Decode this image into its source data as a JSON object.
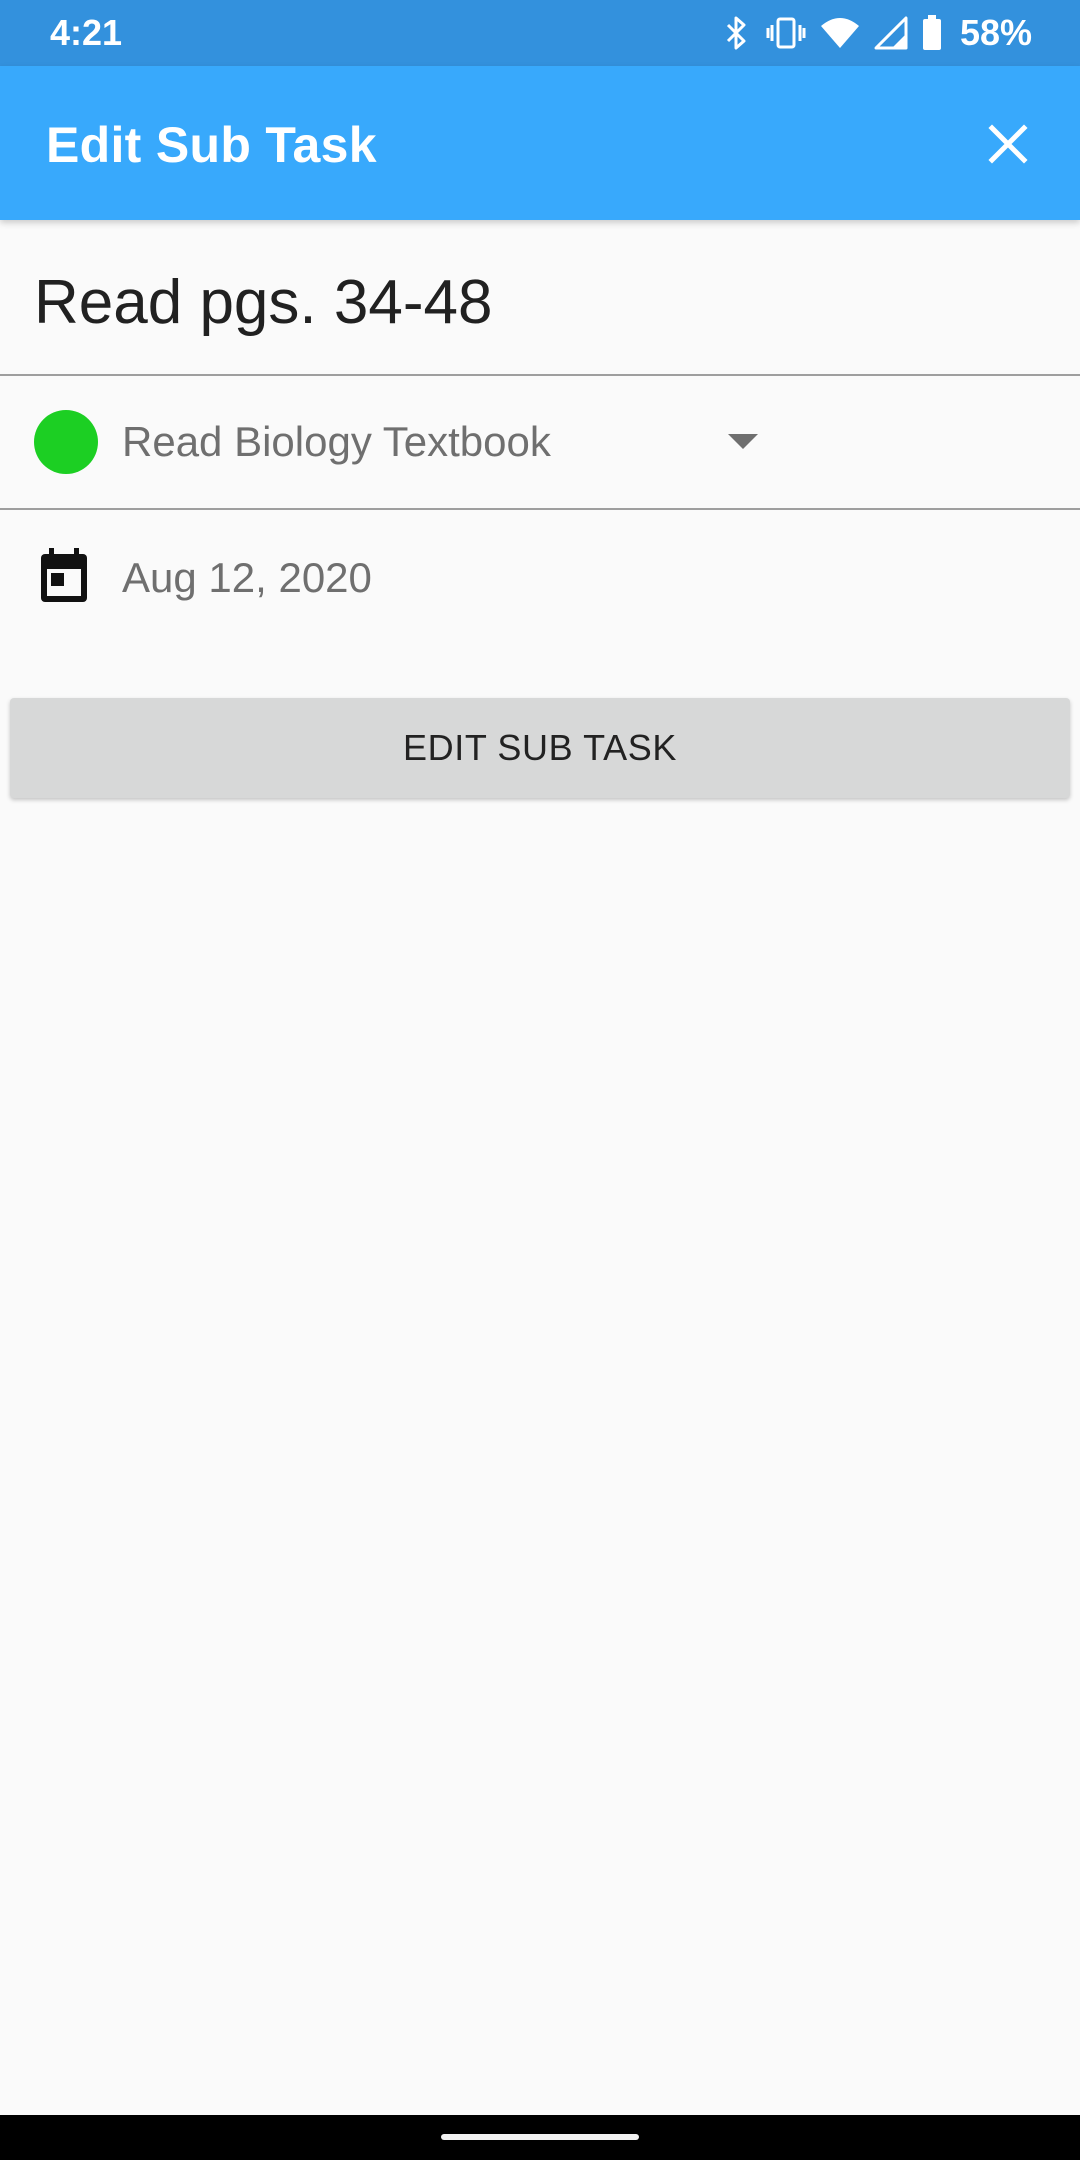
{
  "status_bar": {
    "time": "4:21",
    "battery_percent": "58%",
    "icons": [
      "bluetooth-icon",
      "vibrate-icon",
      "wifi-icon",
      "cell-signal-icon",
      "battery-icon"
    ]
  },
  "app_bar": {
    "title": "Edit Sub Task",
    "close_icon": "close-icon",
    "background": "#38a9fc"
  },
  "form": {
    "name_value": "Read pgs. 34-48",
    "parent_task": {
      "label": "Read Biology Textbook",
      "color": "#1ccf23"
    },
    "date": "Aug 12, 2020"
  },
  "actions": {
    "submit_label": "EDIT SUB TASK"
  }
}
